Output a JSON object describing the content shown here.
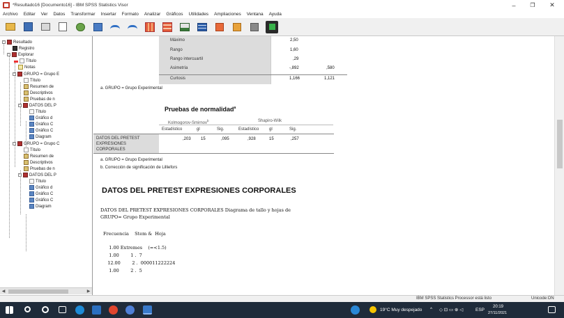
{
  "window": {
    "title": "*Resultado16 [Documento16] - IBM SPSS Statistics Visor",
    "controls": [
      "–",
      "❐",
      "✕"
    ]
  },
  "menubar": [
    "Archivo",
    "Editar",
    "Ver",
    "Datos",
    "Transformar",
    "Insertar",
    "Formato",
    "Analizar",
    "Gráficos",
    "Utilidades",
    "Ampliaciones",
    "Ventana",
    "Ayuda"
  ],
  "toolbar": {
    "buttons": [
      "open-icon",
      "save-icon",
      "print-icon",
      "print-preview-icon",
      "export-icon",
      "recall-dialog-icon",
      "undo-icon",
      "redo-icon",
      "goto-data-icon",
      "goto-case-icon",
      "variables-icon",
      "pivot-icon",
      "promote-icon",
      "demote-icon",
      "hide-icon",
      "show-icon",
      "insert-output-icon"
    ]
  },
  "tree": [
    {
      "label": "Resultado",
      "icon": "book",
      "level": 0
    },
    {
      "label": "Registro",
      "icon": "log",
      "level": 1
    },
    {
      "label": "Explorar",
      "icon": "book",
      "level": 1
    },
    {
      "label": "Título",
      "icon": "title",
      "level": 2
    },
    {
      "label": "Notas",
      "icon": "notes",
      "level": 2
    },
    {
      "label": "GRUPO = Grupo E",
      "icon": "book",
      "level": 2
    },
    {
      "label": "Título",
      "icon": "title",
      "level": 3
    },
    {
      "label": "Resumen de",
      "icon": "table",
      "level": 3
    },
    {
      "label": "Descriptivos",
      "icon": "table",
      "level": 3
    },
    {
      "label": "Pruebas de n",
      "icon": "table",
      "level": 3
    },
    {
      "label": "DATOS DEL P",
      "icon": "book",
      "level": 3
    },
    {
      "label": "Título",
      "icon": "title",
      "level": 4
    },
    {
      "label": "Gráfico d",
      "icon": "chart",
      "level": 4
    },
    {
      "label": "Gráfico C",
      "icon": "chart",
      "level": 4
    },
    {
      "label": "Gráfico C",
      "icon": "chart",
      "level": 4
    },
    {
      "label": "Diagram",
      "icon": "chart",
      "level": 4
    },
    {
      "label": "GRUPO = Grupo C",
      "icon": "book",
      "level": 2
    },
    {
      "label": "Título",
      "icon": "title",
      "level": 3
    },
    {
      "label": "Resumen de",
      "icon": "table",
      "level": 3
    },
    {
      "label": "Descriptivos",
      "icon": "table",
      "level": 3
    },
    {
      "label": "Pruebas de n",
      "icon": "table",
      "level": 3
    },
    {
      "label": "DATOS DEL P",
      "icon": "book",
      "level": 3
    },
    {
      "label": "Título",
      "icon": "title",
      "level": 4
    },
    {
      "label": "Gráfico d",
      "icon": "chart",
      "level": 4
    },
    {
      "label": "Gráfico C",
      "icon": "chart",
      "level": 4
    },
    {
      "label": "Gráfico C",
      "icon": "chart",
      "level": 4
    },
    {
      "label": "Diagram",
      "icon": "chart",
      "level": 4
    }
  ],
  "descriptives_tail": {
    "rows": [
      {
        "label": "Máximo",
        "stat": "2,50",
        "se": ""
      },
      {
        "label": "Rango",
        "stat": "1,60",
        "se": ""
      },
      {
        "label": "Rango intercuartil",
        "stat": ",29",
        "se": ""
      },
      {
        "label": "Asimetría",
        "stat": "-,892",
        "se": ",580"
      },
      {
        "label": "Curtosis",
        "stat": "1,166",
        "se": "1,121"
      }
    ],
    "footnote": "a. GRUPO = Grupo Experimental"
  },
  "normality": {
    "title": "Pruebas de normalidad",
    "title_sup": "a",
    "group1": "Kolmogorov-Smirnov",
    "group1_sup": "b",
    "group2": "Shapiro-Wilk",
    "cols": [
      "Estadístico",
      "gl",
      "Sig.",
      "Estadístico",
      "gl",
      "Sig."
    ],
    "row_label": "DATOS DEL PRETEST EXPRESIONES CORPORALES",
    "values": [
      ",203",
      "15",
      ",095",
      ",928",
      "15",
      ",257"
    ],
    "footnotes": [
      "a. GRUPO = Grupo Experimental",
      "b. Corrección de significación de Lilliefors"
    ]
  },
  "section_heading": "DATOS DEL PRETEST EXPRESIONES CORPORALES",
  "stemleaf": {
    "caption1": "DATOS DEL PRETEST EXPRESIONES CORPORALES Diagrama de tallo y hojas de",
    "caption2": "GRUPO= Grupo Experimental",
    "header": "Frecuencia    Stem &  Hoja",
    "lines": [
      "    1.00 Extremes    (=<1.5)",
      "    1.00        1 .  7",
      "   12.00        2 .  000011222224",
      "    1.00        2 .  5"
    ]
  },
  "statusbar": {
    "processor": "IBM SPSS Statistics Processor está listo",
    "encoding": "Unicode:ON"
  },
  "taskbar": {
    "weather": "19°C  Muy despejado",
    "lang": "ESP",
    "time": "20:19",
    "date": "27/11/2021"
  }
}
